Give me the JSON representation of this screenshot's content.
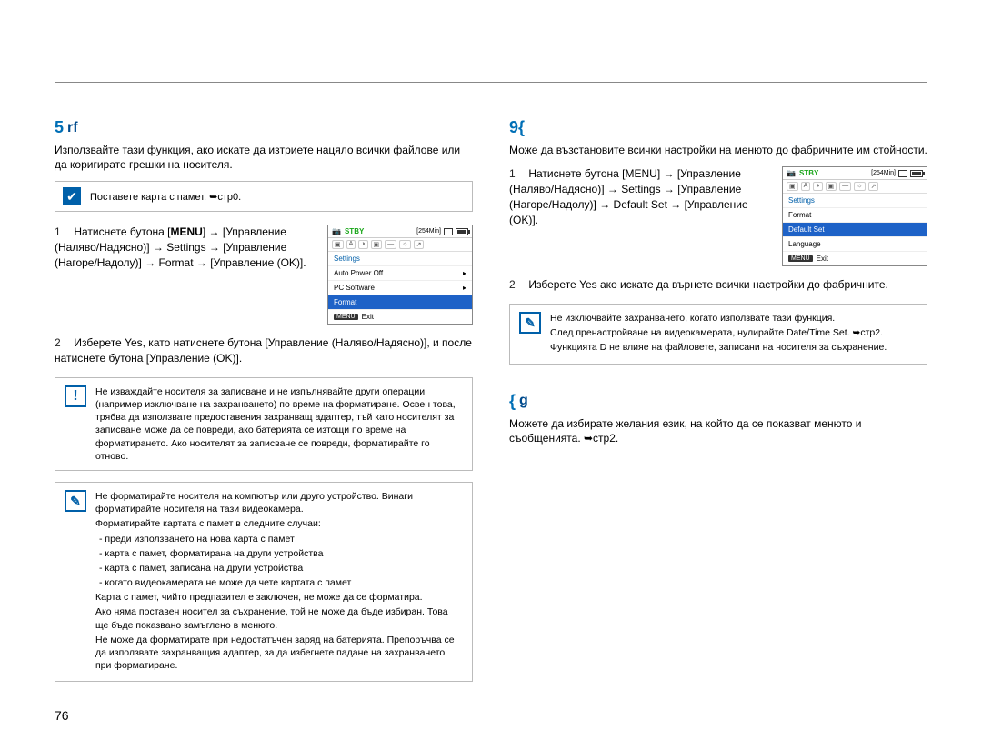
{
  "page_number": "76",
  "left": {
    "title_accent": "5",
    "title_rest": "rf",
    "intro": "Използвайте тази функция, ако искате да изтриете нацяло всички файлове или да коригирате грешки на носителя.",
    "cardbox_text": "Поставете карта с памет. ➥стр0.",
    "step1_pre": "Натиснете бутона [",
    "step1_menu": "MENU",
    "step1_mid1": "] → [Управление (Наляво/Надясно)] → Settings → [Управление (Нагоре/Надолу)] → Format → [Управление (OK)].",
    "step2": "Изберете Yes, като натиснете бутона [Управление (Наляво/Надясно)], и после натиснете бутона [Управление (OK)].",
    "screenshot": {
      "stby": "STBY",
      "time": "[254Min]",
      "item_settings": "Settings",
      "item_autopower": "Auto Power Off",
      "item_pcsoft": "PC Software",
      "item_format": "Format",
      "exit": "Exit",
      "menu": "MENU"
    },
    "note_warn": "Не изваждайте носителя за записване и не изпълнявайте други операции (например изключване на захранването) по време на форматиране. Освен това, трябва да използвате предоставения захранващ адаптер, тъй като носителят за записване може да се повреди, ако батерията се изтощи по време на форматирането. Ако носителят за записване се повреди, форматирайте го отново.",
    "note_info": {
      "l1": "Не форматирайте носителя на компютър или друго устройство. Винаги форматирайте носителя на тази видеокамера.",
      "l2": "Форматирайте картата с памет в следните случаи:",
      "s1": "- преди използването на нова карта с памет",
      "s2": "- карта с памет, форматирана на други устройства",
      "s3": "- карта с памет, записана на други устройства",
      "s4": "- когато видеокамерата не може да чете картата с памет",
      "l3": "Карта с памет, чийто предпазител е заключен, не може да се форматира.",
      "l4": "Ако няма поставен носител за съхранение, той не може да бъде избиран. Това ще бъде показвано замъглено в менюто.",
      "l5": "Не може да форматирате при недостатъчен заряд на батерията. Препоръчва се да използвате захранващия адаптер, за да избегнете падане на захранването при форматиране."
    }
  },
  "right": {
    "section1": {
      "title_accent": "9{",
      "intro": "Може да възстановите всички настройки на менюто до фабричните им стойности.",
      "step1": "Натиснете бутона [MENU] → [Управление (Наляво/Надясно)] → Settings → [Управление (Нагоре/Надолу)] → Default Set → [Управление (OK)].",
      "step2": "Изберете Yes ако искате да върнете всички настройки до фабричните.",
      "screenshot": {
        "stby": "STBY",
        "time": "[254Min]",
        "item_settings": "Settings",
        "item_format": "Format",
        "item_default": "Default Set",
        "item_language": "Language",
        "exit": "Exit",
        "menu": "MENU"
      },
      "note_info": {
        "l1": "Не изключвайте захранването, когато използвате тази функция.",
        "l2": "След пренастройване на видеокамерата, нулирайте Date/Time Set. ➥стр2.",
        "l3": "Функцията D           не влияе на файловете, записани на носителя за съхранение."
      }
    },
    "section2": {
      "title_accent": "{",
      "title_rest": "g",
      "intro": "Можете да избирате желания език, на който да се показват менюто и съобщенията. ➥стр2."
    }
  }
}
